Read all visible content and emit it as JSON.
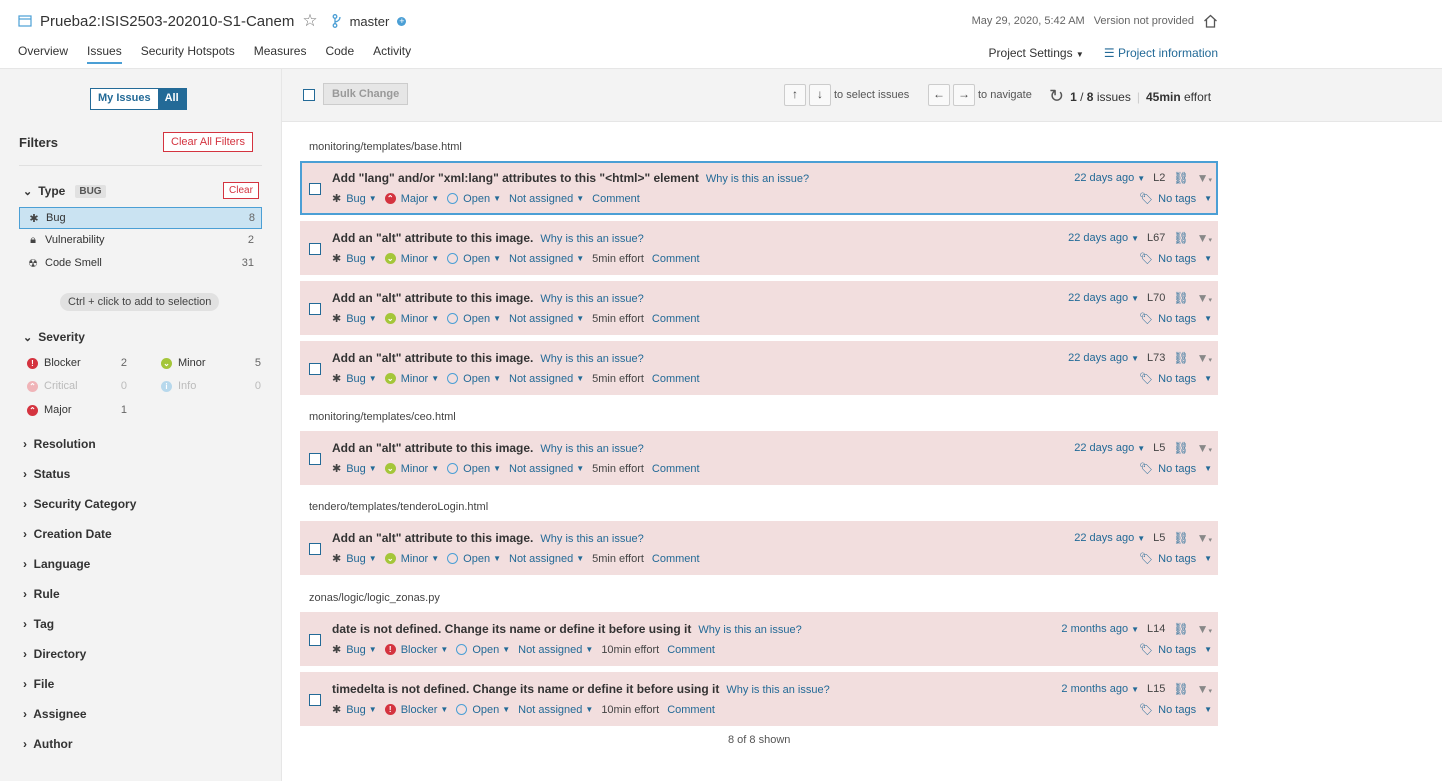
{
  "project": {
    "title": "Prueba2:ISIS2503-202010-S1-Canem",
    "branch": "master",
    "date": "May 29, 2020, 5:42 AM",
    "version": "Version not provided"
  },
  "nav": {
    "tabs": [
      "Overview",
      "Issues",
      "Security Hotspots",
      "Measures",
      "Code",
      "Activity"
    ],
    "active": "Issues",
    "settings": "Project Settings",
    "info": "Project information"
  },
  "sidebar": {
    "my_issues": "My Issues",
    "all": "All",
    "filters": "Filters",
    "clear_all": "Clear All Filters",
    "type": {
      "label": "Type",
      "badge": "BUG",
      "clear": "Clear",
      "items": [
        {
          "label": "Bug",
          "count": "8"
        },
        {
          "label": "Vulnerability",
          "count": "2"
        },
        {
          "label": "Code Smell",
          "count": "31"
        }
      ]
    },
    "hint": "Ctrl + click to add to selection",
    "severity": {
      "label": "Severity",
      "items": [
        {
          "label": "Blocker",
          "count": "2"
        },
        {
          "label": "Minor",
          "count": "5"
        },
        {
          "label": "Critical",
          "count": "0"
        },
        {
          "label": "Info",
          "count": "0"
        },
        {
          "label": "Major",
          "count": "1"
        }
      ]
    },
    "facets": [
      "Resolution",
      "Status",
      "Security Category",
      "Creation Date",
      "Language",
      "Rule",
      "Tag",
      "Directory",
      "File",
      "Assignee",
      "Author"
    ]
  },
  "toolbar": {
    "bulk": "Bulk Change",
    "select_hint": "to select issues",
    "navigate_hint": "to navigate",
    "position": "1",
    "total": "8",
    "issues_word": "issues",
    "effort_value": "45min",
    "effort_word": "effort",
    "up": "↑",
    "down": "↓",
    "left": "←",
    "right": "→"
  },
  "files": [
    "monitoring/templates/base.html",
    "monitoring/templates/ceo.html",
    "tendero/templates/tenderoLogin.html",
    "zonas/logic/logic_zonas.py"
  ],
  "why": "Why is this an issue?",
  "no_tags": "No tags",
  "issues": [
    {
      "msg": "Add \"lang\" and/or \"xml:lang\" attributes to this \"<html>\" element",
      "type": "Bug",
      "severity": "Major",
      "status": "Open",
      "assignee": "Not assigned",
      "effort": "",
      "comment": "Comment",
      "age": "22 days ago",
      "line": "L2"
    },
    {
      "msg": "Add an \"alt\" attribute to this image.",
      "type": "Bug",
      "severity": "Minor",
      "status": "Open",
      "assignee": "Not assigned",
      "effort": "5min effort",
      "comment": "Comment",
      "age": "22 days ago",
      "line": "L67"
    },
    {
      "msg": "Add an \"alt\" attribute to this image.",
      "type": "Bug",
      "severity": "Minor",
      "status": "Open",
      "assignee": "Not assigned",
      "effort": "5min effort",
      "comment": "Comment",
      "age": "22 days ago",
      "line": "L70"
    },
    {
      "msg": "Add an \"alt\" attribute to this image.",
      "type": "Bug",
      "severity": "Minor",
      "status": "Open",
      "assignee": "Not assigned",
      "effort": "5min effort",
      "comment": "Comment",
      "age": "22 days ago",
      "line": "L73"
    },
    {
      "msg": "Add an \"alt\" attribute to this image.",
      "type": "Bug",
      "severity": "Minor",
      "status": "Open",
      "assignee": "Not assigned",
      "effort": "5min effort",
      "comment": "Comment",
      "age": "22 days ago",
      "line": "L5"
    },
    {
      "msg": "Add an \"alt\" attribute to this image.",
      "type": "Bug",
      "severity": "Minor",
      "status": "Open",
      "assignee": "Not assigned",
      "effort": "5min effort",
      "comment": "Comment",
      "age": "22 days ago",
      "line": "L5"
    },
    {
      "msg": "date is not defined. Change its name or define it before using it",
      "type": "Bug",
      "severity": "Blocker",
      "status": "Open",
      "assignee": "Not assigned",
      "effort": "10min effort",
      "comment": "Comment",
      "age": "2 months ago",
      "line": "L14"
    },
    {
      "msg": "timedelta is not defined. Change its name or define it before using it",
      "type": "Bug",
      "severity": "Blocker",
      "status": "Open",
      "assignee": "Not assigned",
      "effort": "10min effort",
      "comment": "Comment",
      "age": "2 months ago",
      "line": "L15"
    }
  ],
  "shown": "8 of 8 shown",
  "colors": {
    "accent": "#236a97",
    "issue_bg": "#f2dede",
    "blocker": "#d4333f",
    "major": "#d4333f",
    "minor": "#a4c639"
  }
}
